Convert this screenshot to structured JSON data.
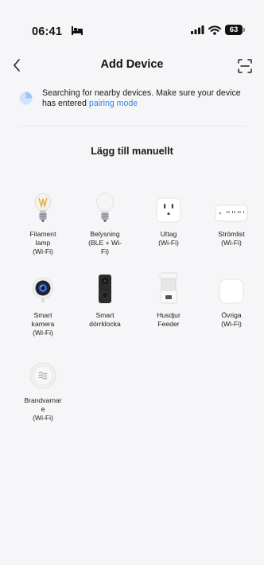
{
  "status_bar": {
    "time": "06:41",
    "battery": "63"
  },
  "header": {
    "title": "Add Device"
  },
  "searching": {
    "message": "Searching for nearby devices. Make sure your device has entered",
    "link": "pairing mode"
  },
  "section": {
    "title": "Lägg till manuellt"
  },
  "devices": [
    {
      "label": "Filament\nlamp\n(Wi-Fi)",
      "icon": "filament-bulb-icon"
    },
    {
      "label": "Belysning\n(BLE + Wi-\nFi)",
      "icon": "led-bulb-icon"
    },
    {
      "label": "Uttag\n(Wi-Fi)",
      "icon": "wall-outlet-icon"
    },
    {
      "label": "Strömlist\n(Wi-Fi)",
      "icon": "power-strip-icon"
    },
    {
      "label": "Smart\nkamera\n(Wi-Fi)",
      "icon": "camera-icon"
    },
    {
      "label": "Smart\ndörrklocka",
      "icon": "doorbell-icon"
    },
    {
      "label": "Husdjur\nFeeder",
      "icon": "pet-feeder-icon"
    },
    {
      "label": "Övriga\n(Wi-Fi)",
      "icon": "generic-device-icon"
    },
    {
      "label": "Brandvarnar\ne\n(Wi-Fi)",
      "icon": "smoke-alarm-icon"
    }
  ]
}
